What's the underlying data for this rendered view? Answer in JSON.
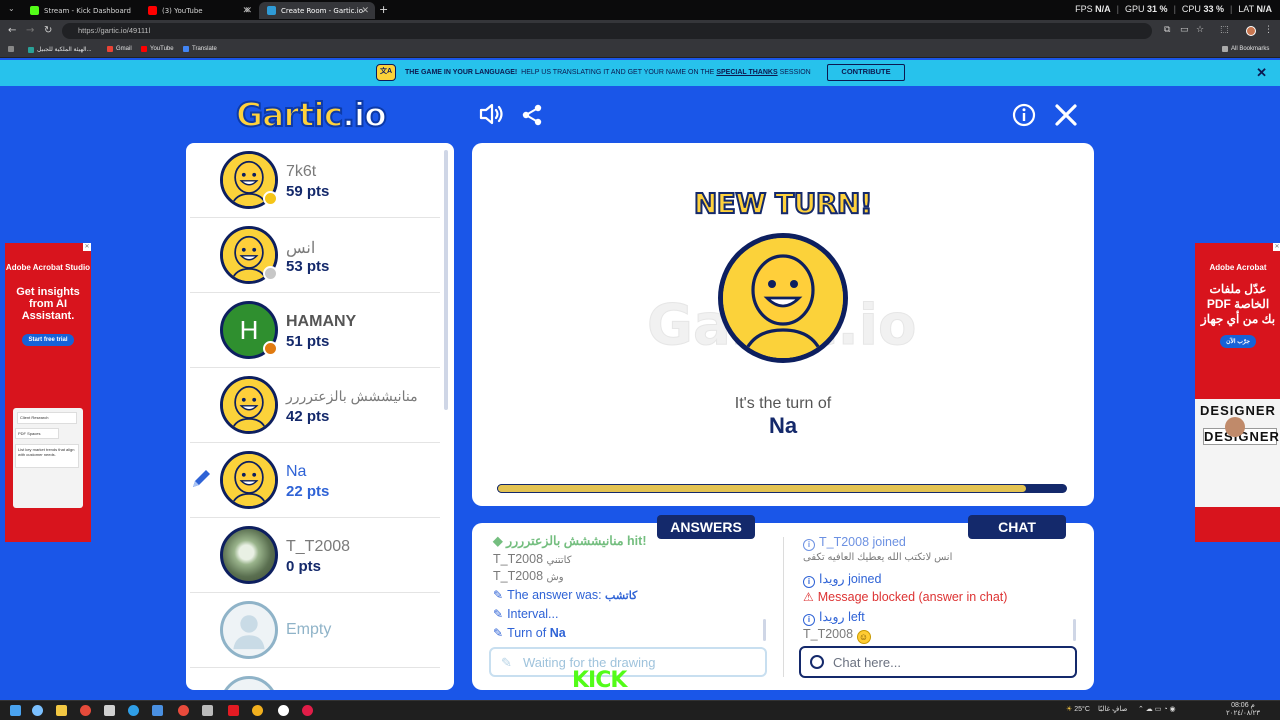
{
  "browser": {
    "tabs": [
      {
        "label": "Stream - Kick Dashboard",
        "color": "#53fc18"
      },
      {
        "label": "(3) YouTube",
        "color": "#ff0000"
      },
      {
        "label": "Create Room - Gartic.io",
        "color": "#2f9bd6"
      }
    ],
    "url": "https://gartic.io/49111l",
    "bookmarks": [
      "الهيئة الملكية للجبيل...",
      "Gmail",
      "YouTube",
      "Translate"
    ],
    "all_bookmarks": "All Bookmarks",
    "perf": {
      "fps_label": "FPS",
      "fps": "N/A",
      "gpu_label": "GPU",
      "gpu": "31 %",
      "cpu_label": "CPU",
      "cpu": "33 %",
      "lat_label": "LAT",
      "lat": "N/A"
    }
  },
  "banner": {
    "title": "THE GAME IN YOUR LANGUAGE!",
    "text": "HELP US TRANSLATING IT AND GET YOUR NAME ON THE",
    "link": "SPECIAL THANKS",
    "suffix": "SESSION",
    "button": "CONTRIBUTE"
  },
  "header": {
    "logo": "Gartic",
    "logo_suffix": ".io"
  },
  "players": [
    {
      "name": "7k6t",
      "points": "59 pts",
      "avatar": "face",
      "badge": "#f5c518"
    },
    {
      "name": "انس",
      "points": "53 pts",
      "avatar": "face",
      "badge": "#c7c7c7"
    },
    {
      "name": "HAMANY",
      "points": "51 pts",
      "avatar": "letter",
      "letter": "H",
      "badge": "#e07a10"
    },
    {
      "name": "منانيششش بالزعترررر",
      "points": "42 pts",
      "avatar": "face"
    },
    {
      "name": "Na",
      "points": "22 pts",
      "avatar": "face",
      "current": true
    },
    {
      "name": "T_T2008",
      "points": "0 pts",
      "avatar": "photo"
    },
    {
      "name": "Empty",
      "points": "",
      "avatar": "empty"
    }
  ],
  "turn": {
    "heading": "NEW TURN!",
    "watermark": "Gartic.io",
    "text": "It's the turn of",
    "player": "Na",
    "progress": 0.93
  },
  "answers": {
    "tab": "ANSWERS",
    "lines": [
      {
        "text": "منانيششش بالزعترررر hit!",
        "style": "green"
      },
      {
        "author": "T_T2008",
        "text": "كاتتني"
      },
      {
        "author": "T_T2008",
        "text": "وش"
      },
      {
        "text": "The answer was:",
        "extra": "كاتشب",
        "icon": "pencil"
      },
      {
        "text": "Interval...",
        "icon": "pencil"
      },
      {
        "text": "Turn of",
        "extra": "Na",
        "icon": "pencil"
      }
    ],
    "placeholder": "Waiting for the drawing"
  },
  "chat": {
    "tab": "CHAT",
    "lines": [
      {
        "text": "T_T2008 joined",
        "icon": "info"
      },
      {
        "author": "انس",
        "text": "لاتكتب الله يعطيك العافيه تكفى"
      },
      {
        "text": "رويدا joined",
        "icon": "info"
      },
      {
        "text": "Message blocked (answer in chat)",
        "icon": "warn"
      },
      {
        "text": "رويدا left",
        "icon": "info"
      },
      {
        "author": "T_T2008",
        "text": "",
        "icon": "smile"
      }
    ],
    "placeholder": "Chat here..."
  },
  "ads": {
    "left": {
      "brand": "Adobe Acrobat Studio",
      "headline": "Get insights from AI Assistant.",
      "cta": "Start free trial",
      "card1": "Client Research",
      "card2": "PDF Spaces",
      "card3": "List key market trends that align with customer needs."
    },
    "right": {
      "brand": "Adobe Acrobat",
      "headline": "عدّل ملفات PDF الخاصة بك من أي جهاز",
      "cta": "جرّب الآن",
      "designer": "DESIGNER"
    }
  },
  "overlay": {
    "kick": "KICK"
  },
  "taskbar": {
    "weather": "25°C",
    "weather_text": "صافٍ غالبًا",
    "time": "08:06 م",
    "date": "٢٠٢٤/٠٨/٢٣"
  }
}
